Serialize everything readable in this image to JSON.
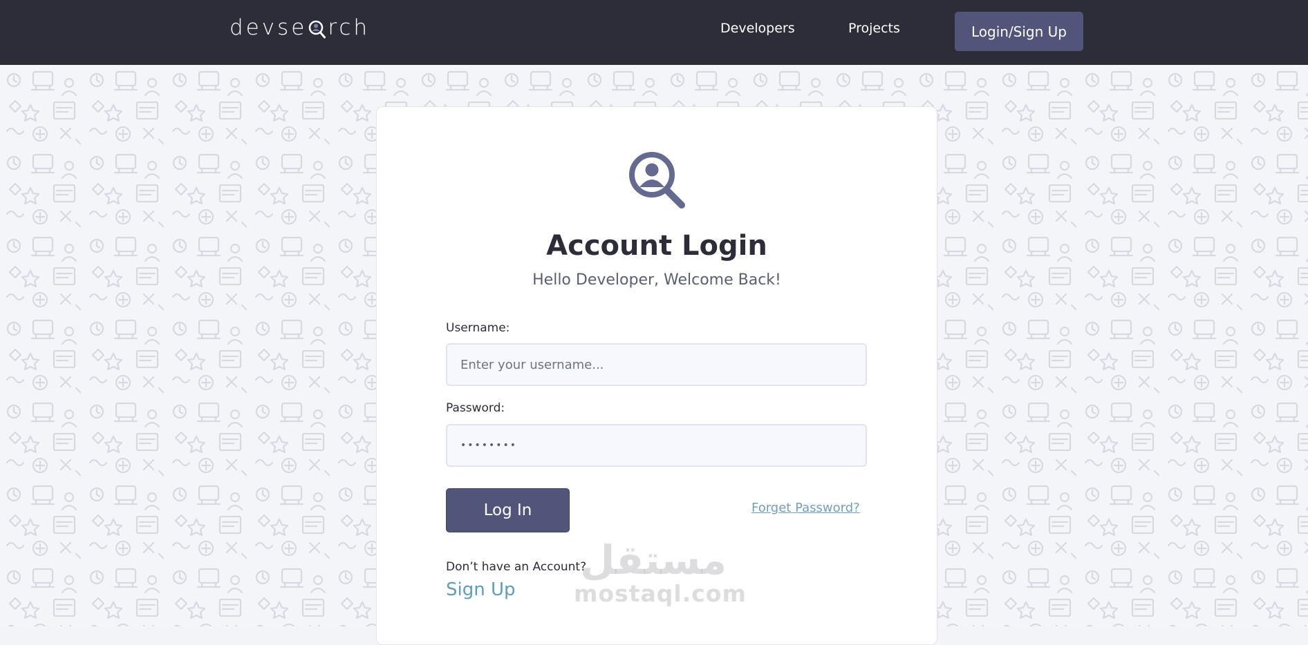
{
  "nav": {
    "logo_left": "devse",
    "logo_right": "rch",
    "links": [
      {
        "label": "Developers"
      },
      {
        "label": "Projects"
      }
    ],
    "login_button": "Login/Sign Up"
  },
  "card": {
    "title": "Account Login",
    "subtitle": "Hello Developer, Welcome Back!",
    "username_label": "Username:",
    "username_placeholder": "Enter your username...",
    "password_label": "Password:",
    "password_value": "••••••••",
    "login_button": "Log In",
    "forget_password": "Forget Password?",
    "no_account_text": "Don’t have an Account?",
    "signup_link": "Sign Up"
  },
  "watermark": {
    "arabic": "مستقل",
    "latin": "mostaql.com"
  },
  "colors": {
    "navbar": "#2d2d39",
    "accent": "#51557a",
    "link": "#5f9cbf",
    "background": "#f4f5f8"
  },
  "icons": {
    "card_icon": "user-search-icon",
    "logo_icon": "magnifier-person-icon"
  }
}
